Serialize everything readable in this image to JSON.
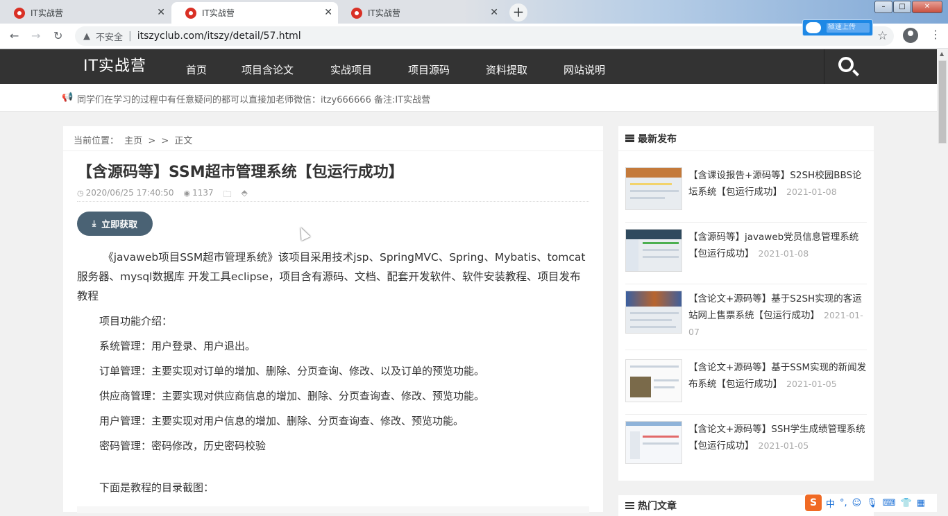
{
  "browser": {
    "tabs": [
      {
        "title": "IT实战营",
        "active": false
      },
      {
        "title": "IT实战营",
        "active": true
      },
      {
        "title": "IT实战营",
        "active": false
      }
    ],
    "new_tab": "+",
    "security_label": "不安全",
    "url": "itszyclub.com/itszy/detail/57.html",
    "window_controls": {
      "minimize": "–",
      "maximize": "□",
      "close": "✕"
    },
    "icons": {
      "back": "back-arrow-icon",
      "forward": "forward-arrow-icon",
      "reload": "reload-icon",
      "star": "bookmark-star-icon",
      "account": "account-icon",
      "menu": "kebab-menu-icon"
    },
    "cloud_badge": "極速上传"
  },
  "site": {
    "logo": "IT实战营",
    "nav": [
      "首页",
      "项目含论文",
      "实战项目",
      "项目源码",
      "资料提取",
      "网站说明"
    ],
    "notice": "同学们在学习的过程中有任意疑问的都可以直接加老师微信：itzy666666 备注:IT实战营"
  },
  "article": {
    "breadcrumb": [
      "当前位置：",
      "主页",
      ">",
      ">",
      "正文"
    ],
    "title": "【含源码等】SSM超市管理系统【包运行成功】",
    "date": "2020/06/25 17:40:50",
    "views": "1137",
    "download_label": "立即获取",
    "intro": "《javaweb项目SSM超市管理系统》该项目采用技术jsp、SpringMVC、Spring、Mybatis、tomcat服务器、mysql数据库 开发工具eclipse，项目含有源码、文档、配套开发软件、软件安装教程、项目发布教程",
    "features": [
      "项目功能介绍：",
      "系统管理：用户登录、用户退出。",
      "订单管理：主要实现对订单的增加、删除、分页查询、修改、以及订单的预览功能。",
      "供应商管理：主要实现对供应商信息的增加、删除、分页查询查、修改、预览功能。",
      "用户管理：主要实现对用户信息的增加、删除、分页查询查、修改、预览功能。",
      "密码管理：密码修改，历史密码校验"
    ],
    "screenshot_heading": "下面是教程的目录截图："
  },
  "sidebar": {
    "latest_title": "最新发布",
    "posts": [
      {
        "title": "【含课设报告+源码等】S2SH校园BBS论坛系统【包运行成功】",
        "date": "2021-01-08"
      },
      {
        "title": "【含源码等】javaweb党员信息管理系统【包运行成功】",
        "date": "2021-01-08"
      },
      {
        "title": "【含论文+源码等】基于S2SH实现的客运站网上售票系统【包运行成功】",
        "date": "2021-01-07"
      },
      {
        "title": "【含论文+源码等】基于SSM实现的新闻发布系统【包运行成功】",
        "date": "2021-01-05"
      },
      {
        "title": "【含论文+源码等】SSH学生成绩管理系统【包运行成功】",
        "date": "2021-01-05"
      }
    ],
    "hot_title": "热门文章"
  },
  "ime": {
    "logo": "S",
    "lang": "中",
    "punct": "°,"
  },
  "colors": {
    "header_bg": "#333333",
    "button_bg": "#4a6274",
    "page_bg": "#f1f1f1"
  }
}
